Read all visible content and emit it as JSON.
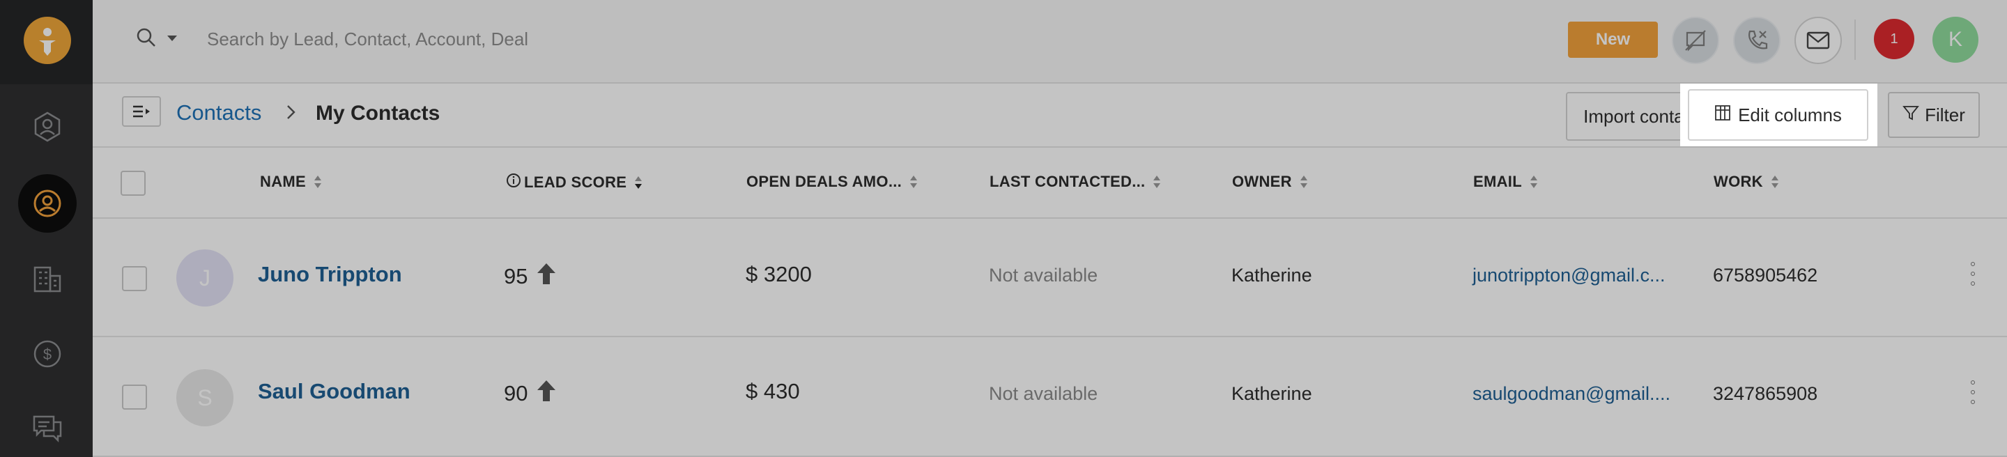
{
  "search": {
    "placeholder": "Search by Lead, Contact, Account, Deal"
  },
  "header": {
    "new_label": "New",
    "notification_count": "1",
    "user_initial": "K"
  },
  "breadcrumb": {
    "parent": "Contacts",
    "current": "My Contacts"
  },
  "toolbar": {
    "import_label": "Import contacts",
    "edit_columns_label": "Edit columns",
    "filter_label": "Filter"
  },
  "table": {
    "columns": [
      "NAME",
      "LEAD SCORE",
      "OPEN DEALS AMO...",
      "LAST CONTACTED...",
      "OWNER",
      "EMAIL",
      "WORK"
    ],
    "rows": [
      {
        "initial": "J",
        "name": "Juno Trippton",
        "lead_score": "95",
        "open_deals": "$ 3200",
        "last_contacted": "Not available",
        "owner": "Katherine",
        "email": "junotrippton@gmail.c...",
        "work": "6758905462"
      },
      {
        "initial": "S",
        "name": "Saul Goodman",
        "lead_score": "90",
        "open_deals": "$ 430",
        "last_contacted": "Not available",
        "owner": "Katherine",
        "email": "saulgoodman@gmail....",
        "work": "3247865908"
      }
    ]
  },
  "colors": {
    "accent_orange": "#f2a23c",
    "link_blue": "#1f5f93",
    "rail_dark": "#2f3031",
    "notification_red": "#de2a2f",
    "avatar_green": "#8fdb9d"
  },
  "icons": {
    "rail": [
      "contacts-logo-icon",
      "user-circle-icon",
      "contact-active-icon",
      "building-icon",
      "dollar-icon",
      "chat-icon"
    ],
    "topbar": [
      "search-icon",
      "chevron-down-icon",
      "chat-off-icon",
      "phone-off-icon",
      "mail-icon"
    ]
  }
}
